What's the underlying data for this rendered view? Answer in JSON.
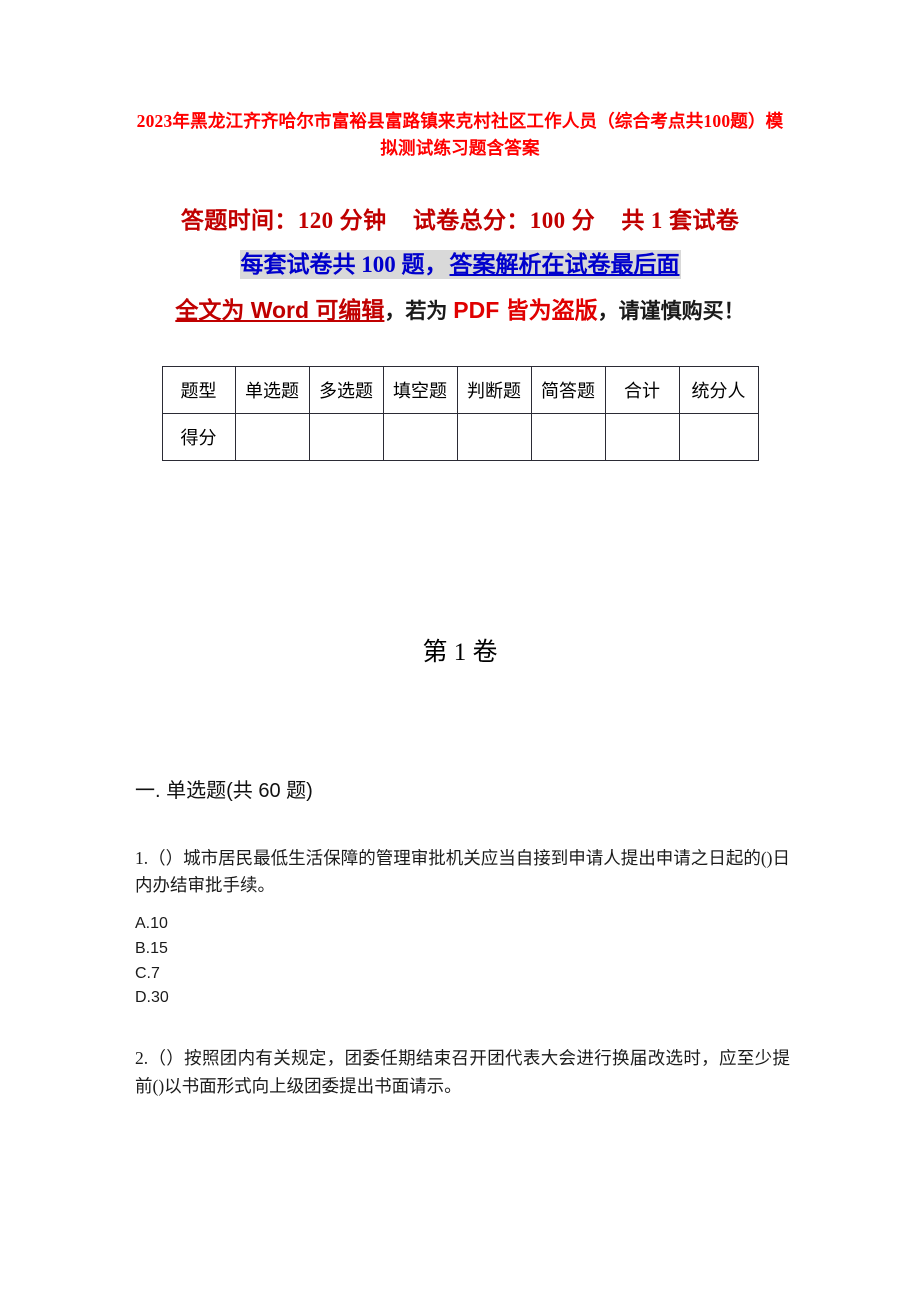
{
  "document": {
    "title": "2023年黑龙江齐齐哈尔市富裕县富路镇来克村社区工作人员（综合考点共100题）模拟测试练习题含答案"
  },
  "banner": {
    "line1": {
      "time_label": "答题时间：120 分钟",
      "total_label": "试卷总分：100 分",
      "sets_label": "共 1 套试卷"
    },
    "line2": {
      "part_a": "每套试卷共 100 题，",
      "part_b": "答案解析在试卷最后面"
    },
    "line3": {
      "part_a": "全文为 Word 可编辑",
      "part_b": "，若为 ",
      "part_c": "PDF 皆为盗版",
      "part_d": "，请谨慎购买！"
    }
  },
  "score_table": {
    "header": [
      "题型",
      "单选题",
      "多选题",
      "填空题",
      "判断题",
      "简答题",
      "合计",
      "统分人"
    ],
    "rows": [
      {
        "label": "得分",
        "cells": [
          "",
          "",
          "",
          "",
          "",
          "",
          ""
        ]
      }
    ]
  },
  "volume": {
    "heading": "第 1 卷"
  },
  "section": {
    "heading": "一. 单选题(共 60 题)"
  },
  "questions": [
    {
      "number": "1.",
      "text": "1.（）城市居民最低生活保障的管理审批机关应当自接到申请人提出申请之日起的()日内办结审批手续。",
      "options": [
        "A.10",
        "B.15",
        "C.7",
        "D.30"
      ]
    },
    {
      "number": "2.",
      "text": "2.（）按照团内有关规定，团委任期结束召开团代表大会进行换届改选时，应至少提前()以书面形式向上级团委提出书面请示。",
      "options": []
    }
  ],
  "colors": {
    "title_red": "#ff0000",
    "dark_red": "#c00000",
    "blue": "#0000cc",
    "highlight_gray": "#d9d9d9",
    "text_black": "#1b1b1b"
  }
}
